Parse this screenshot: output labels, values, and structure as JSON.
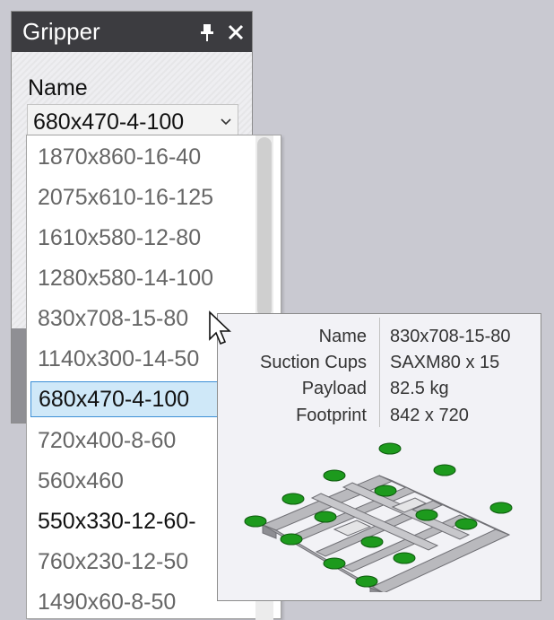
{
  "panel": {
    "title": "Gripper",
    "pin_icon": "pin-icon",
    "close_icon": "close-icon",
    "name_label": "Name",
    "combo_value": "680x470-4-100",
    "combo_icon": "chevron-down-icon"
  },
  "dropdown": {
    "items": [
      "1870x860-16-40",
      "2075x610-16-125",
      "1610x580-12-80",
      "1280x580-14-100",
      "830x708-15-80",
      "1140x300-14-50",
      "680x470-4-100",
      "720x400-8-60",
      "560x460",
      "550x330-12-60-",
      "760x230-12-50",
      "1490x60-8-50"
    ],
    "selected": "680x470-4-100"
  },
  "tooltip": {
    "rows": [
      {
        "key": "Name",
        "value": "830x708-15-80"
      },
      {
        "key": "Suction Cups",
        "value": "SAXM80 x 15"
      },
      {
        "key": "Payload",
        "value": "82.5 kg"
      },
      {
        "key": "Footprint",
        "value": "842 x 720"
      }
    ],
    "image": "gripper-3d-preview",
    "cup_color": "#1d9a1d",
    "frame_color": "#b9b9bd"
  },
  "colors": {
    "header_bg": "#3c3c40",
    "selected_bg": "#cfe8f8",
    "selected_border": "#3c8fd6"
  }
}
